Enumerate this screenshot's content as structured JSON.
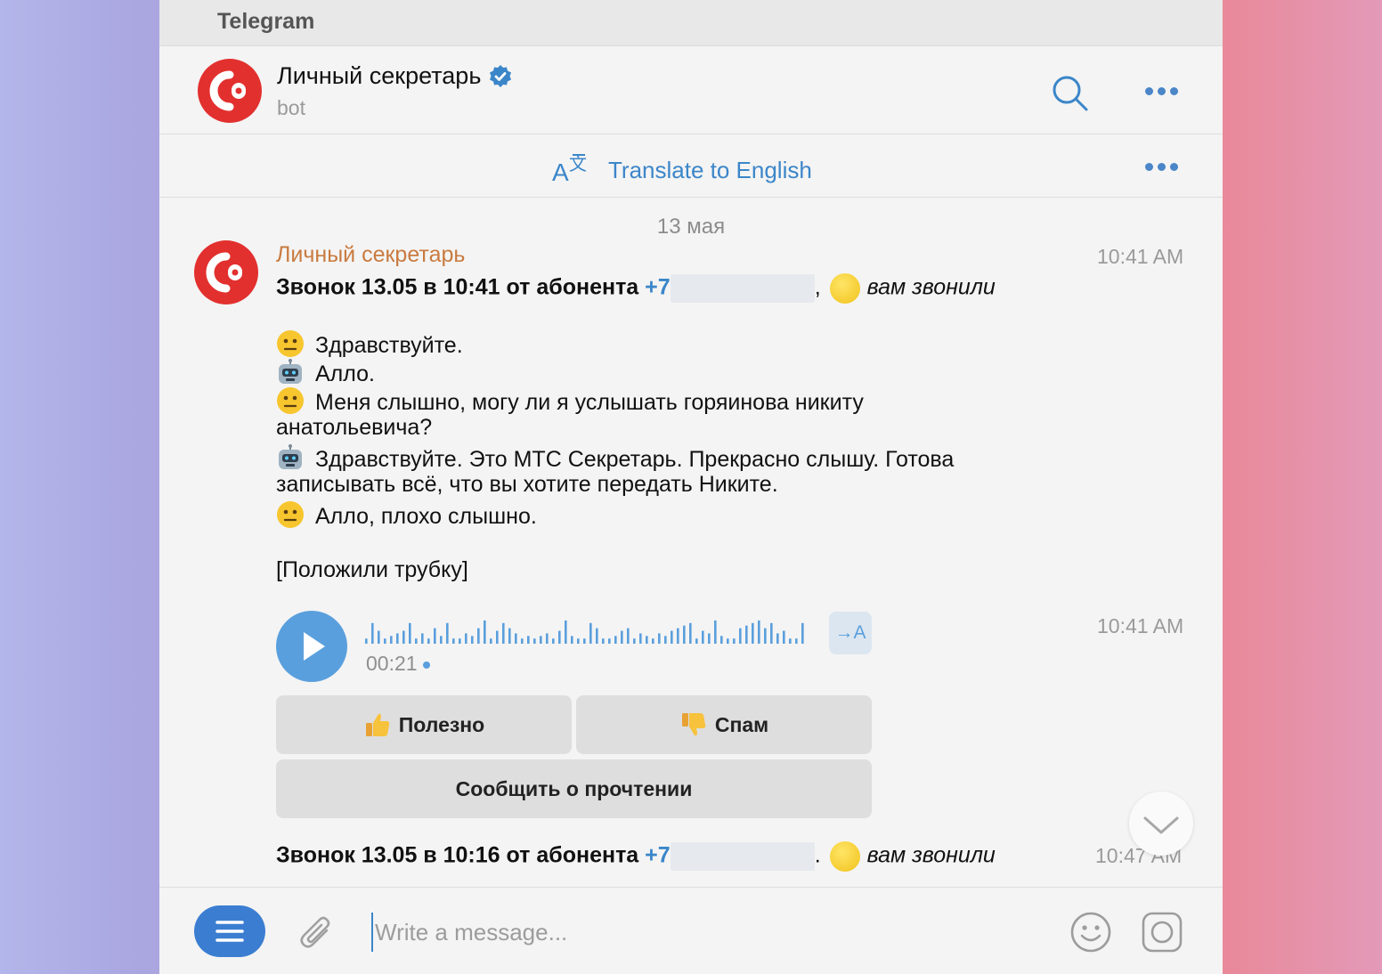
{
  "app": {
    "title": "Telegram"
  },
  "header": {
    "name": "Личный секретарь",
    "subtitle": "bot"
  },
  "translate": {
    "label": "Translate to English"
  },
  "date_separator": "13 мая",
  "message1": {
    "sender": "Личный секретарь",
    "time": "10:41 AM",
    "call_prefix": "Звонок 13.05 в 10:41 от абонента",
    "phone": "+7",
    "comma": ",",
    "call_status": "вам звонили",
    "lines": [
      {
        "speaker": "caller",
        "text": "Здравствуйте."
      },
      {
        "speaker": "bot",
        "text": "Алло."
      },
      {
        "speaker": "caller",
        "text": "Меня слышно, могу ли я услышать горяинова никиту"
      },
      {
        "speaker": "none",
        "text": "анатольевича?"
      },
      {
        "speaker": "bot",
        "text": "Здравствуйте. Это МТС Секретарь. Прекрасно слышу. Готова"
      },
      {
        "speaker": "none",
        "text": "записывать всё, что вы хотите передать Никите."
      },
      {
        "speaker": "caller",
        "text": "Алло, плохо слышно."
      }
    ],
    "hangup": "[Положили трубку]"
  },
  "voice": {
    "duration": "00:21",
    "time": "10:41 AM",
    "transcribe_label": "→A"
  },
  "buttons": {
    "useful": "Полезно",
    "spam": "Спам",
    "report": "Сообщить о прочтении"
  },
  "message2": {
    "call_prefix": "Звонок 13.05 в 10:16 от абонента",
    "phone": "+7",
    "comma": ".",
    "call_status": "вам звонили",
    "time": "10:47 AM"
  },
  "composer": {
    "placeholder": "Write a message..."
  },
  "colors": {
    "accent": "#3b86c9",
    "brand_red": "#e2302e",
    "sender": "#c97b40"
  }
}
